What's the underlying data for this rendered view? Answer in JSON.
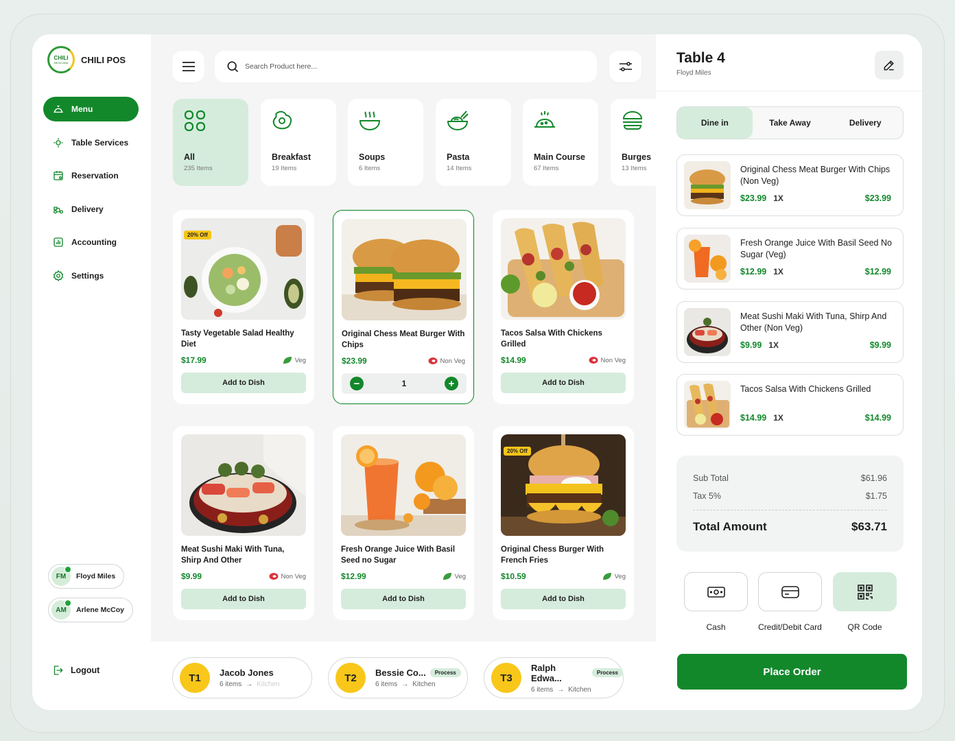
{
  "brand": {
    "logo_line1": "CHILI",
    "logo_line2": "MEXICANA",
    "name": "CHILI POS"
  },
  "sidebar": {
    "items": [
      {
        "label": "Menu",
        "icon": "cloche-icon"
      },
      {
        "label": "Table Services",
        "icon": "table-icon"
      },
      {
        "label": "Reservation",
        "icon": "calendar-icon"
      },
      {
        "label": "Delivery",
        "icon": "scooter-icon"
      },
      {
        "label": "Accounting",
        "icon": "chart-icon"
      },
      {
        "label": "Settings",
        "icon": "gear-icon"
      }
    ],
    "staff": [
      {
        "initials": "FM",
        "name": "Floyd Miles"
      },
      {
        "initials": "AM",
        "name": "Arlene McCoy"
      }
    ],
    "logout": "Logout"
  },
  "search": {
    "placeholder": "Search Product here..."
  },
  "categories": [
    {
      "name": "All",
      "count": "235 Items"
    },
    {
      "name": "Breakfast",
      "count": "19 Items"
    },
    {
      "name": "Soups",
      "count": "6 Items"
    },
    {
      "name": "Pasta",
      "count": "14 Items"
    },
    {
      "name": "Main Course",
      "count": "67 Items"
    },
    {
      "name": "Burges",
      "count": "13 Items"
    }
  ],
  "products": [
    {
      "title": "Tasty Vegetable Salad Healthy Diet",
      "price": "$17.99",
      "tag": "Veg",
      "badge": "20% Off",
      "button": "Add to Dish"
    },
    {
      "title": "Original Chess Meat Burger With Chips",
      "price": "$23.99",
      "tag": "Non Veg",
      "qty": "1"
    },
    {
      "title": "Tacos Salsa With Chickens Grilled",
      "price": "$14.99",
      "tag": "Non Veg",
      "button": "Add to Dish"
    },
    {
      "title": "Meat Sushi Maki With Tuna, Shirp And Other",
      "price": "$9.99",
      "tag": "Non Veg",
      "button": "Add to Dish"
    },
    {
      "title": "Fresh Orange Juice With Basil Seed no Sugar",
      "price": "$12.99",
      "tag": "Veg",
      "button": "Add to Dish"
    },
    {
      "title": "Original Chess Burger With French Fries",
      "price": "$10.59",
      "tag": "Veg",
      "badge": "20% Off",
      "button": "Add to Dish"
    }
  ],
  "queue": [
    {
      "num": "T1",
      "name": "Jacob Jones",
      "items": "6 items",
      "dest": "Kitchen",
      "status": ""
    },
    {
      "num": "T2",
      "name": "Bessie Co...",
      "items": "6 items",
      "dest": "Kitchen",
      "status": "Process"
    },
    {
      "num": "T3",
      "name": "Ralph Edwa...",
      "items": "6 items",
      "dest": "Kitchen",
      "status": "Process"
    }
  ],
  "order": {
    "title": "Table 4",
    "customer": "Floyd Miles",
    "tabs": [
      "Dine in",
      "Take Away",
      "Delivery"
    ],
    "items": [
      {
        "name": "Original Chess Meat Burger With Chips (Non Veg)",
        "price": "$23.99",
        "qty": "1X",
        "total": "$23.99"
      },
      {
        "name": "Fresh Orange Juice With Basil Seed No Sugar (Veg)",
        "price": "$12.99",
        "qty": "1X",
        "total": "$12.99"
      },
      {
        "name": "Meat Sushi Maki With Tuna, Shirp And Other (Non Veg)",
        "price": "$9.99",
        "qty": "1X",
        "total": "$9.99"
      },
      {
        "name": "Tacos Salsa With Chickens Grilled",
        "price": "$14.99",
        "qty": "1X",
        "total": "$14.99"
      }
    ],
    "summary": {
      "subtotal_label": "Sub Total",
      "subtotal": "$61.96",
      "tax_label": "Tax 5%",
      "tax": "$1.75",
      "total_label": "Total Amount",
      "total": "$63.71"
    },
    "payments": [
      "Cash",
      "Credit/Debit Card",
      "QR Code"
    ],
    "place_order": "Place Order"
  },
  "colors": {
    "accent": "#12882b",
    "accent_light": "#d5ecdc",
    "queue_yellow": "#f8c71a"
  }
}
